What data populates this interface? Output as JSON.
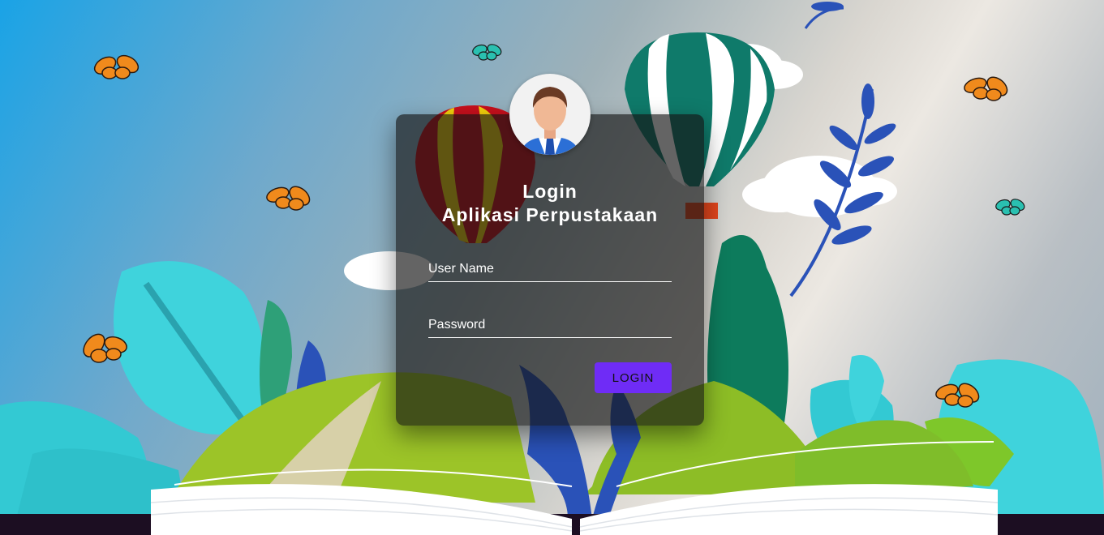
{
  "login": {
    "title_line1": "Login",
    "title_line2": "Aplikasi Perpustakaan",
    "username_label": "User Name",
    "password_label": "Password",
    "button_label": "LOGIN"
  },
  "colors": {
    "button": "#6f2cf6",
    "card": "rgba(20,20,20,0.66)"
  },
  "icons": [
    "user-avatar-icon",
    "butterfly-icon",
    "hot-air-balloon-icon",
    "leaf-icon",
    "cloud-icon",
    "open-book-icon"
  ]
}
